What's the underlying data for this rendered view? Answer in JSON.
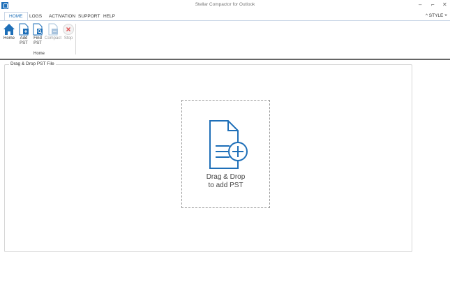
{
  "window": {
    "title": "Stellar Compactor for Outlook",
    "controls": {
      "minimize": "–",
      "restore": "⌐",
      "close": "✕"
    }
  },
  "menu": {
    "tabs": [
      {
        "label": "HOME",
        "active": true
      },
      {
        "label": "LOGS",
        "active": false
      },
      {
        "label": "ACTIVATION",
        "active": false
      },
      {
        "label": "SUPPORT",
        "active": false
      },
      {
        "label": "HELP",
        "active": false
      }
    ],
    "style_label": "^ STYLE ˅"
  },
  "ribbon": {
    "group_label": "Home",
    "buttons": [
      {
        "label": "Home",
        "icon": "home-icon",
        "enabled": true
      },
      {
        "label": "Add\nPST",
        "icon": "add-pst-icon",
        "enabled": true
      },
      {
        "label": "Find\nPST",
        "icon": "find-pst-icon",
        "enabled": true
      },
      {
        "label": "Compact",
        "icon": "compact-icon",
        "enabled": false
      },
      {
        "label": "Stop",
        "icon": "stop-icon",
        "enabled": false
      }
    ]
  },
  "main": {
    "frame_title": "Drag & Drop PST File",
    "drop_text_line1": "Drag & Drop",
    "drop_text_line2": "to add PST"
  },
  "colors": {
    "accent": "#1e6fb8",
    "disabled": "#9a9a9a",
    "stop": "#e05555"
  }
}
